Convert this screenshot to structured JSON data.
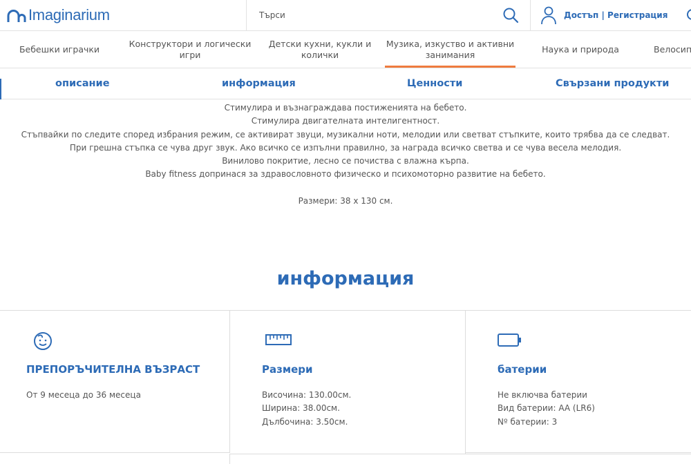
{
  "header": {
    "logo_text": "Imaginarium",
    "search_placeholder": "Търси",
    "login_label": "Достъп | Регистрация"
  },
  "nav": {
    "items": [
      {
        "label": "Бебешки играчки"
      },
      {
        "label": "Конструктори и логически игри"
      },
      {
        "label": "Детски кухни, кукли и колички"
      },
      {
        "label": "Музика, изкуство и активни занимания"
      },
      {
        "label": "Наука и природа"
      },
      {
        "label": "Велосипеди"
      }
    ],
    "active_index": 3
  },
  "tabs": [
    {
      "label": "описание"
    },
    {
      "label": "информация"
    },
    {
      "label": "Ценности"
    },
    {
      "label": "Свързани продукти"
    }
  ],
  "description": {
    "lines": [
      "Стимулира и възнаграждава постиженията на бебето.",
      "Стимулира двигателната интелигентност.",
      "Стъпвайки по следите според избрания режим, се активират звуци, музикални ноти, мелодии или светват стъпките, които трябва да се следват.",
      "При грешна стъпка се чува друг звук. Ако всичко се изпълни правилно, за награда всичко светва и се чува весела мелодия.",
      "Винилово покритие, лесно се почиства с влажна кърпа.",
      "Baby fitness допринася за здравословното физическо и психомоторно развитие на бебето."
    ],
    "sizes": "Размери: 38 х 130 см."
  },
  "info": {
    "title": "информация",
    "age": {
      "icon": "baby-face-icon",
      "title": "ПРЕПОРЪЧИТЕЛНА ВЪЗРАСТ",
      "text": "От 9 месеца до 36 месеца"
    },
    "dimensions": {
      "icon": "ruler-icon",
      "title": "Размери",
      "height": "Височина: 130.00см.",
      "width": "Ширина: 38.00см.",
      "depth": "Дълбочина: 3.50см."
    },
    "batteries": {
      "icon": "battery-icon",
      "title": "батерии",
      "included": "Не включва батерии",
      "type": "Вид батерии: AA (LR6)",
      "count": "Nº батерии: 3"
    }
  },
  "colors": {
    "brand_blue": "#2d6bb6",
    "accent_orange": "#ef7b3e"
  }
}
